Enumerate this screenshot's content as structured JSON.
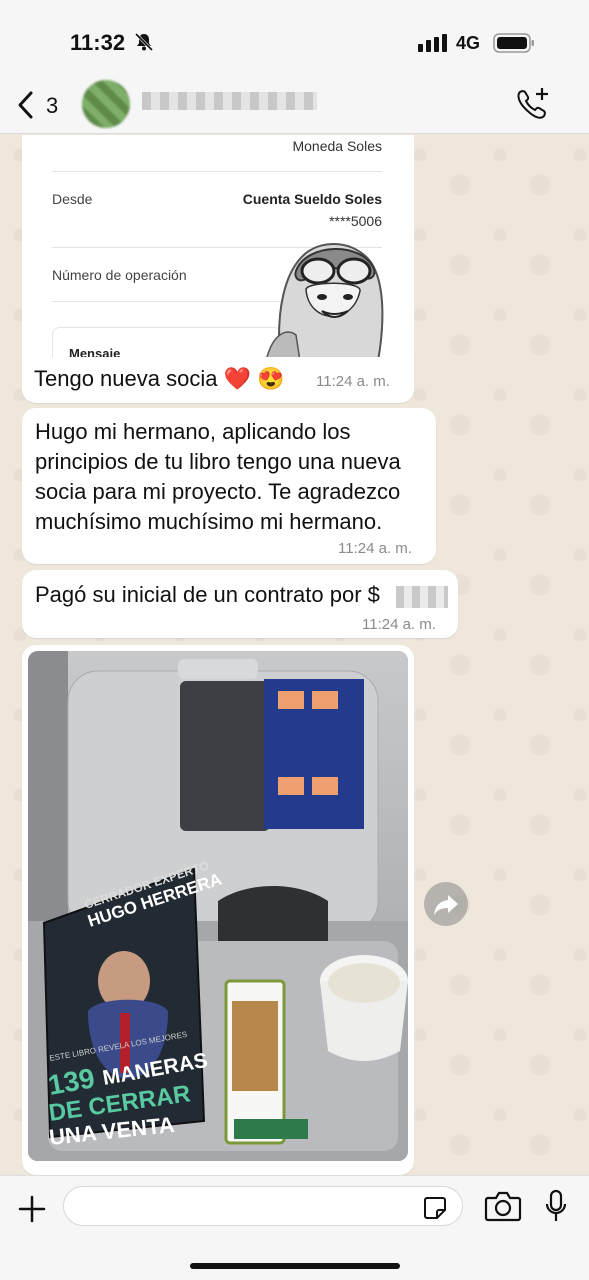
{
  "status_bar": {
    "time": "11:32",
    "network": "4G"
  },
  "header": {
    "unread_count": "3",
    "contact_name": ""
  },
  "receipt": {
    "currency_value": "Moneda Soles",
    "from_label": "Desde",
    "from_account": "Cuenta Sueldo Soles",
    "from_number": "****5006",
    "operation_label": "Número de operación",
    "message_label": "Mensaje"
  },
  "messages": [
    {
      "text": "Tengo nueva socia ❤️ 😍",
      "time": "11:24 a. m."
    },
    {
      "text": "Hugo mi hermano, aplicando los principios de tu libro tengo una nueva socia para mi proyecto. Te agradezco muchísimo muchísimo mi hermano.",
      "time": "11:24 a. m."
    },
    {
      "text": "Pagó su inicial de un contrato por $",
      "time": "11:24 a. m."
    }
  ],
  "photo": {
    "book_top": "CERRADOR EXPERTO",
    "book_author": "HUGO HERRERA",
    "book_tagline": "ESTE LIBRO REVELA LOS MEJORES",
    "book_number": "139",
    "book_title_1": "MANERAS",
    "book_title_2": "DE CERRAR",
    "book_title_3": "UNA VENTA"
  },
  "input": {
    "placeholder": ""
  },
  "colors": {
    "chat_bg": "#efe7dc",
    "bubble": "#ffffff",
    "bar": "#f6f6f6"
  }
}
